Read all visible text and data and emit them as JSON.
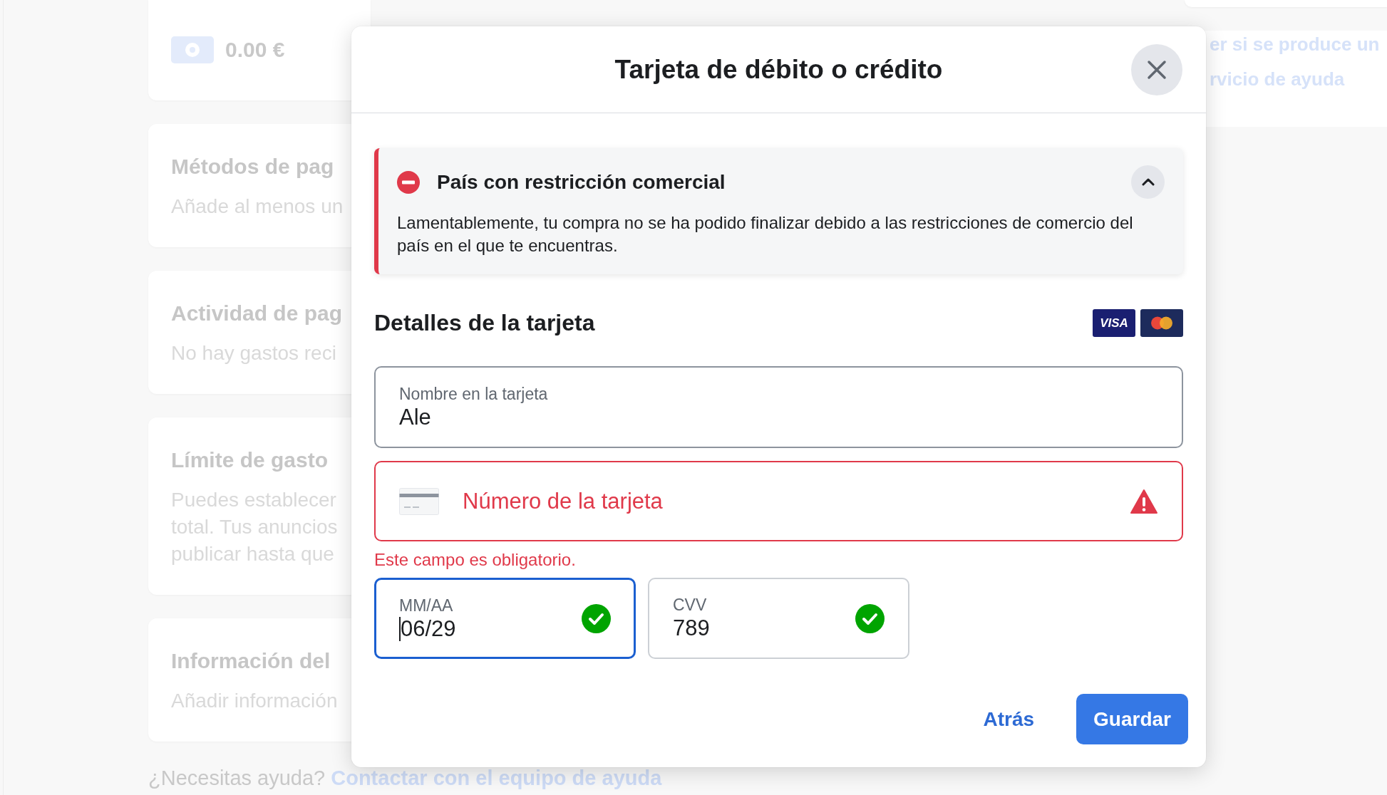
{
  "background": {
    "balance": {
      "amount": "0.00 €"
    },
    "sections": [
      {
        "title": "Métodos de pag",
        "lines": [
          "Añade al menos un"
        ]
      },
      {
        "title": "Actividad de pag",
        "lines": [
          "No hay gastos reci"
        ]
      },
      {
        "title": "Límite de gasto",
        "lines": [
          "Puedes establecer",
          "total. Tus anuncios",
          "publicar hasta que"
        ]
      },
      {
        "title": "Información del",
        "lines": [
          "Añadir información"
        ]
      }
    ],
    "help": {
      "text": "¿Necesitas ayuda?",
      "link": "Contactar con el equipo de ayuda"
    },
    "side_card": {
      "lines": [
        "er si se produce un",
        "rvicio de ayuda"
      ]
    }
  },
  "dialog": {
    "title": "Tarjeta de débito o crédito",
    "alert": {
      "title": "País con restricción comercial",
      "message": "Lamentablemente, tu compra no se ha podido finalizar debido a las restricciones de comercio del país en el que te encuentras.",
      "expanded": true
    },
    "card_details": {
      "heading": "Detalles de la tarjeta",
      "accepted_cards": [
        {
          "kind": "visa",
          "label": "VISA"
        },
        {
          "kind": "mastercard"
        }
      ],
      "name_field": {
        "label": "Nombre en la tarjeta",
        "value": "Ale"
      },
      "number_field": {
        "placeholder": "Número de la tarjeta",
        "error": true,
        "error_message": "Este campo es obligatorio."
      },
      "expiry_field": {
        "label": "MM/AA",
        "value": "06/29",
        "focused": true,
        "valid": true
      },
      "cvv_field": {
        "label": "CVV",
        "value": "789",
        "focused": false,
        "valid": true
      }
    },
    "buttons": [
      {
        "kind": "link",
        "label": "Atrás"
      },
      {
        "kind": "primary",
        "label": "Guardar"
      }
    ]
  }
}
